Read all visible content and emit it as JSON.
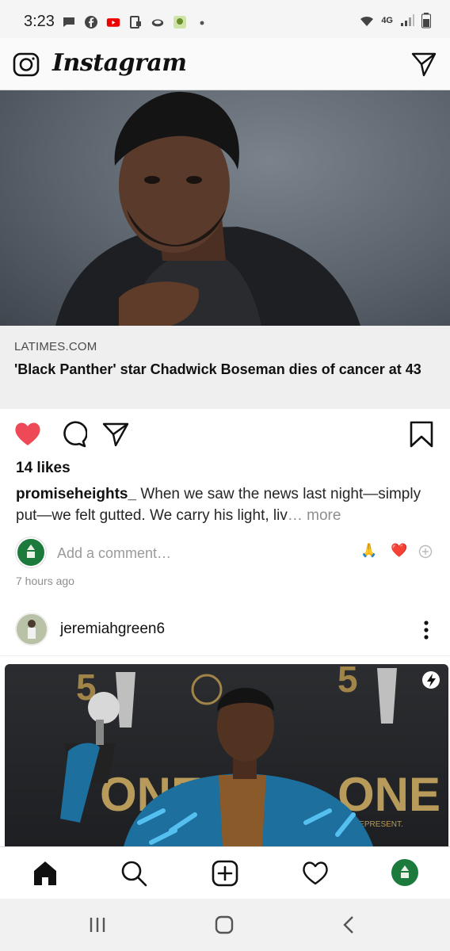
{
  "status": {
    "time": "3:23",
    "network": "4G"
  },
  "app": {
    "brand": "Instagram"
  },
  "post1": {
    "link_source": "LATIMES.COM",
    "link_title": "'Black Panther' star Chadwick Boseman dies of cancer at 43",
    "likes": "14 likes",
    "caption_user": "promiseheights_",
    "caption_text": " When we saw the news last night—simply put—we felt gutted. We carry his light, liv",
    "caption_more": "… more",
    "add_comment_placeholder": "Add a comment…",
    "quick_reactions": [
      "🙏",
      "❤️"
    ],
    "timestamp": "7 hours ago"
  },
  "post2": {
    "username": "jeremiahgreen6",
    "photo_backdrop_text": "ONE",
    "photo_backdrop_sub": "REPRESENT."
  },
  "colors": {
    "like_red": "#ed4956",
    "text": "#262626",
    "secondary": "#8e8e8e",
    "avatar_green": "#1b7a3c"
  },
  "icons": {
    "header": [
      "camera-icon",
      "direct-send-icon"
    ],
    "actions": [
      "heart-filled-icon",
      "comment-icon",
      "share-icon",
      "bookmark-icon"
    ],
    "bottom_nav": [
      "home-icon",
      "search-icon",
      "new-post-icon",
      "activity-heart-icon",
      "profile-avatar"
    ],
    "system_nav": [
      "recents-icon",
      "home-circle-icon",
      "back-icon"
    ]
  }
}
